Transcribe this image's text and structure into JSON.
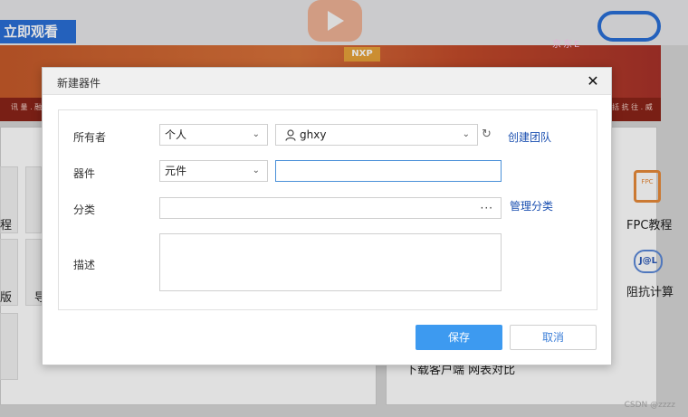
{
  "background": {
    "watch_button": "立即观看",
    "nxp_logo": "NXP",
    "jd_text": "京东E",
    "banner_small_text": "讯 量 . 融",
    "banner_small_text_right": "括   抗 往 . 威",
    "left_labels": [
      "程",
      "版",
      "导"
    ],
    "right_labels": [
      "FPC教程",
      "阻抗计算"
    ],
    "fpc_icon_text": "FPC",
    "jat_icon_text": "J@L",
    "bottom_text": "下载客户端    网表对比",
    "watermark": "CSDN @zzzz"
  },
  "dialog": {
    "title": "新建器件",
    "close": "✕",
    "owner": {
      "label": "所有者",
      "type_value": "个人",
      "user_value": "ghxy",
      "create_team": "创建团队"
    },
    "device": {
      "label": "器件",
      "type_value": "元件",
      "name_value": ""
    },
    "category": {
      "label": "分类",
      "value": "",
      "more": "···",
      "manage": "管理分类"
    },
    "description": {
      "label": "描述",
      "value": ""
    },
    "buttons": {
      "save": "保存",
      "cancel": "取消"
    }
  }
}
